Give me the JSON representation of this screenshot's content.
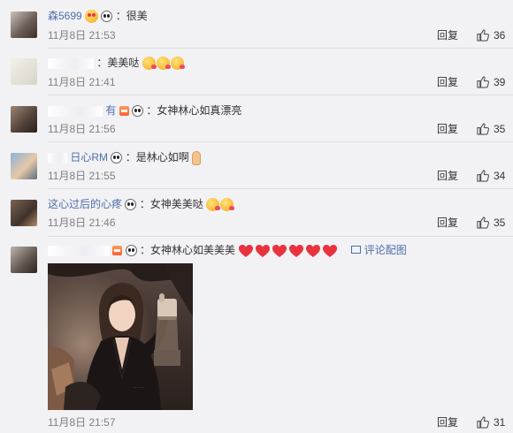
{
  "comments": [
    {
      "avatar": "user-avatar",
      "nick_fragment": "森5699",
      "text": "：很美",
      "time": "11月8日 21:53",
      "reply": "回复",
      "likes": "36"
    },
    {
      "avatar": "user-avatar",
      "text": "：美美哒",
      "time": "11月8日 21:41",
      "reply": "回复",
      "likes": "39"
    },
    {
      "avatar": "user-avatar",
      "nick_fragment": "有",
      "text": "：女神林心如真漂亮",
      "time": "11月8日 21:56",
      "reply": "回复",
      "likes": "35"
    },
    {
      "avatar": "user-avatar",
      "nick_fragment": "日心RM",
      "text": "：是林心如啊",
      "time": "11月8日 21:55",
      "reply": "回复",
      "likes": "34"
    },
    {
      "avatar": "user-avatar",
      "nick_fragment": "这心过后的心疼",
      "text": "：女神美美哒",
      "time": "11月8日 21:46",
      "reply": "回复",
      "likes": "35"
    },
    {
      "avatar": "user-avatar",
      "text": "：女神林心如美美美",
      "photo_link": "评论配图",
      "time": "11月8日 21:57",
      "reply": "回复",
      "likes": "31"
    }
  ],
  "icons": {
    "like": "thumbs-up-icon",
    "panda": "panda-icon",
    "vip": "vip-badge-icon",
    "kiss": "kiss-emoji-icon",
    "heart": "red-heart-icon",
    "hand": "hand-emoji-icon",
    "photo": "image-icon"
  },
  "colors": {
    "background": "#f2f2f5",
    "nickname": "#4d6ea8",
    "timestamp": "#808080",
    "heart": "#e8333f",
    "separator": "#dcdce2"
  }
}
